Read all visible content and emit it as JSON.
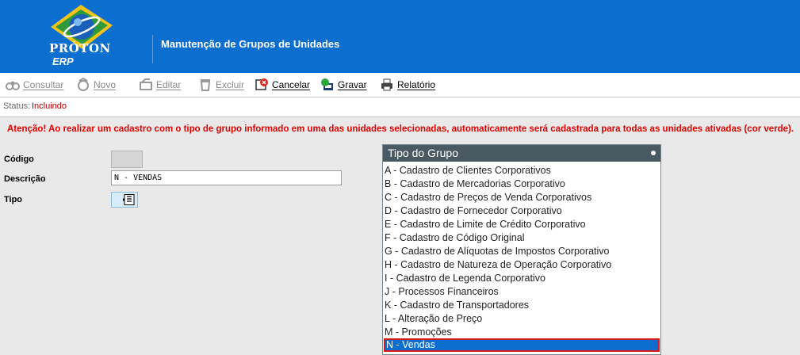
{
  "header": {
    "brand": "PRÓTON",
    "brand_sub": "ERP",
    "page_title": "Manutenção de Grupos de Unidades"
  },
  "toolbar": [
    {
      "label": "Consultar",
      "icon": "binoculars-icon",
      "enabled": false
    },
    {
      "label": "Novo",
      "icon": "new-document-icon",
      "enabled": false
    },
    {
      "label": "Editar",
      "icon": "edit-icon",
      "enabled": false
    },
    {
      "label": "Excluir",
      "icon": "trash-icon",
      "enabled": false
    },
    {
      "label": "Cancelar",
      "icon": "cancel-icon",
      "enabled": true
    },
    {
      "label": "Gravar",
      "icon": "save-icon",
      "enabled": true
    },
    {
      "label": "Relatório",
      "icon": "printer-icon",
      "enabled": true
    }
  ],
  "status": {
    "label": "Status:",
    "value": "Incluindo"
  },
  "warning": "Atenção! Ao realizar um cadastro com o tipo de grupo informado em uma das unidades selecionadas, automaticamente será cadastrada para todas as unidades ativadas (cor verde).",
  "form": {
    "codigo_label": "Código",
    "codigo_value": "",
    "descricao_label": "Descrição",
    "descricao_value": "N - VENDAS",
    "tipo_label": "Tipo"
  },
  "popup": {
    "title": "Tipo do Grupo",
    "options": [
      "A - Cadastro de Clientes Corporativos",
      "B - Cadastro de Mercadorias Corporativo",
      "C - Cadastro de Preços de Venda Corporativos",
      "D - Cadastro de Fornecedor Corporativo",
      "E - Cadastro de Limite de Crédito Corporativo",
      "F - Cadastro de Código Original",
      "G - Cadastro de Alíquotas de Impostos Corporativo",
      "H - Cadastro de Natureza de Operação Corporativo",
      "I - Cadastro de Legenda Corporativo",
      "J - Processos Financeiros",
      "K - Cadastro de Transportadores",
      "L - Alteração de Preço",
      "M - Promoções",
      "N - Vendas"
    ],
    "selected": "N - Vendas"
  },
  "colors": {
    "header_bg": "#0c6fcf",
    "warning": "#e00000",
    "status_value": "#b00000",
    "popup_header": "#4a5a63",
    "selection": "#0c6fcf",
    "selection_border": "#d8181f"
  }
}
